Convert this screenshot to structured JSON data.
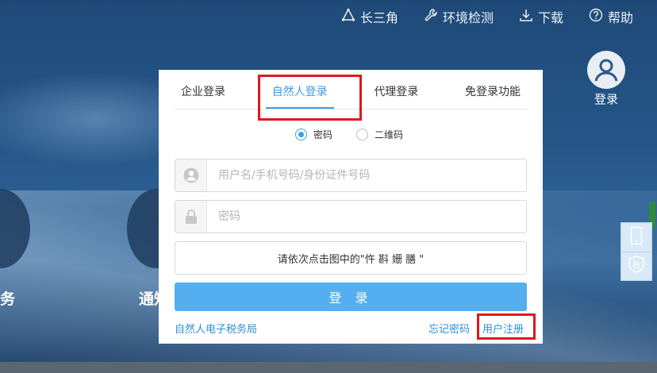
{
  "nav": {
    "items": [
      {
        "label": "长三角",
        "icon": "triangle-network-icon"
      },
      {
        "label": "环境检测",
        "icon": "wrench-icon"
      },
      {
        "label": "下载",
        "icon": "download-icon"
      },
      {
        "label": "帮助",
        "icon": "help-icon"
      }
    ]
  },
  "account": {
    "login_label": "登录"
  },
  "background": {
    "service_left": "务",
    "service_center": "通知"
  },
  "login_panel": {
    "tabs": [
      {
        "label": "企业登录",
        "active": false
      },
      {
        "label": "自然人登录",
        "active": true
      },
      {
        "label": "代理登录",
        "active": false
      },
      {
        "label": "免登录功能",
        "active": false
      }
    ],
    "mode_options": [
      {
        "label": "密码",
        "checked": true
      },
      {
        "label": "二维码",
        "checked": false
      }
    ],
    "username_placeholder": "用户名/手机号码/身份证件号码",
    "password_placeholder": "密码",
    "captcha_prompt": "请依次点击图中的\"忤 斟 姗 膳 \"",
    "login_button": "登 录",
    "link_tax_bureau": "自然人电子税务局",
    "link_forgot": "忘记密码",
    "link_register": "用户注册"
  },
  "side_tools": [
    {
      "icon": "mobile-phone-icon"
    },
    {
      "icon": "tax-shield-icon",
      "label": "税"
    }
  ],
  "colors": {
    "accent": "#3d9be5",
    "login_button": "#55aef0",
    "highlight": "#e0171e",
    "background": "#245587"
  }
}
